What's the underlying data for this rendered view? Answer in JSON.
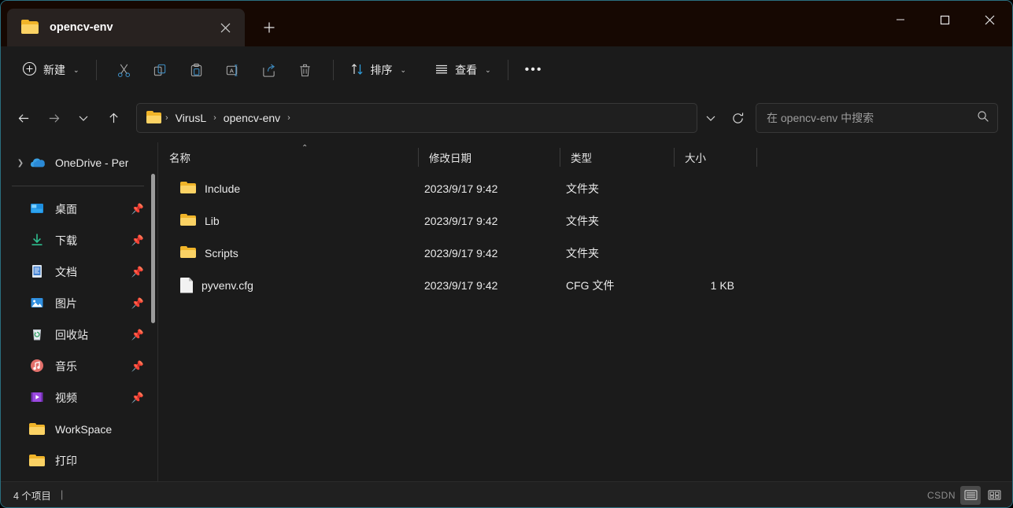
{
  "window": {
    "accent_border": "#2a6f80",
    "titlebar_bg": "#160802",
    "chrome_bg": "#1b1b1b"
  },
  "titlebar": {
    "tab": {
      "icon": "folder-icon",
      "title": "opencv-env",
      "close_icon": "close-icon"
    },
    "new_tab_icon": "plus-icon",
    "controls": {
      "minimize": "minimize-icon",
      "maximize": "maximize-icon",
      "close": "close-icon"
    }
  },
  "toolbar": {
    "new_label": "新建",
    "new_icon": "plus-circle-icon",
    "icons": [
      {
        "name": "cut-icon",
        "title": "剪切"
      },
      {
        "name": "copy-icon",
        "title": "复制"
      },
      {
        "name": "paste-icon",
        "title": "粘贴"
      },
      {
        "name": "rename-icon",
        "title": "重命名"
      },
      {
        "name": "share-icon",
        "title": "共享"
      },
      {
        "name": "delete-icon",
        "title": "删除"
      }
    ],
    "sort_label": "排序",
    "sort_icon": "sort-arrows-icon",
    "view_label": "查看",
    "view_icon": "view-list-icon",
    "more_label": "•••"
  },
  "addressbar": {
    "back_icon": "arrow-left-icon",
    "forward_icon": "arrow-right-icon",
    "recent_icon": "chevron-down-icon",
    "up_icon": "arrow-up-icon",
    "breadcrumb": [
      "VirusL",
      "opencv-env"
    ],
    "breadcrumb_separator": "›",
    "dropdown_icon": "chevron-down-icon",
    "refresh_icon": "refresh-icon",
    "search_placeholder": "在 opencv-env 中搜索",
    "search_value": "",
    "search_icon": "search-icon"
  },
  "sidebar": {
    "items": [
      {
        "label": "OneDrive - Per",
        "icon": "onedrive-icon",
        "expandable": true,
        "pinned": false
      },
      {
        "label": "桌面",
        "icon": "desktop-icon",
        "expandable": false,
        "pinned": true
      },
      {
        "label": "下载",
        "icon": "downloads-icon",
        "expandable": false,
        "pinned": true
      },
      {
        "label": "文档",
        "icon": "documents-icon",
        "expandable": false,
        "pinned": true
      },
      {
        "label": "图片",
        "icon": "pictures-icon",
        "expandable": false,
        "pinned": true
      },
      {
        "label": "回收站",
        "icon": "recyclebin-icon",
        "expandable": false,
        "pinned": true
      },
      {
        "label": "音乐",
        "icon": "music-icon",
        "expandable": false,
        "pinned": true
      },
      {
        "label": "视频",
        "icon": "videos-icon",
        "expandable": false,
        "pinned": true
      },
      {
        "label": "WorkSpace",
        "icon": "folder-icon",
        "expandable": false,
        "pinned": false
      },
      {
        "label": "打印",
        "icon": "folder-icon",
        "expandable": false,
        "pinned": false
      }
    ]
  },
  "filelist": {
    "columns": [
      {
        "key": "name",
        "label": "名称",
        "sorted": true,
        "sort_caret": "⌃"
      },
      {
        "key": "date",
        "label": "修改日期",
        "sorted": false
      },
      {
        "key": "type",
        "label": "类型",
        "sorted": false
      },
      {
        "key": "size",
        "label": "大小",
        "sorted": false
      }
    ],
    "rows": [
      {
        "icon": "folder-icon",
        "name": "Include",
        "date": "2023/9/17 9:42",
        "type": "文件夹",
        "size": ""
      },
      {
        "icon": "folder-icon",
        "name": "Lib",
        "date": "2023/9/17 9:42",
        "type": "文件夹",
        "size": ""
      },
      {
        "icon": "folder-icon",
        "name": "Scripts",
        "date": "2023/9/17 9:42",
        "type": "文件夹",
        "size": ""
      },
      {
        "icon": "file-icon",
        "name": "pyvenv.cfg",
        "date": "2023/9/17 9:42",
        "type": "CFG 文件",
        "size": "1 KB"
      }
    ]
  },
  "statusbar": {
    "item_count": "4 个项目",
    "separator": "|",
    "watermark": "CSDN",
    "details_view_icon": "details-view-icon",
    "large_icons_view_icon": "large-icons-view-icon"
  }
}
